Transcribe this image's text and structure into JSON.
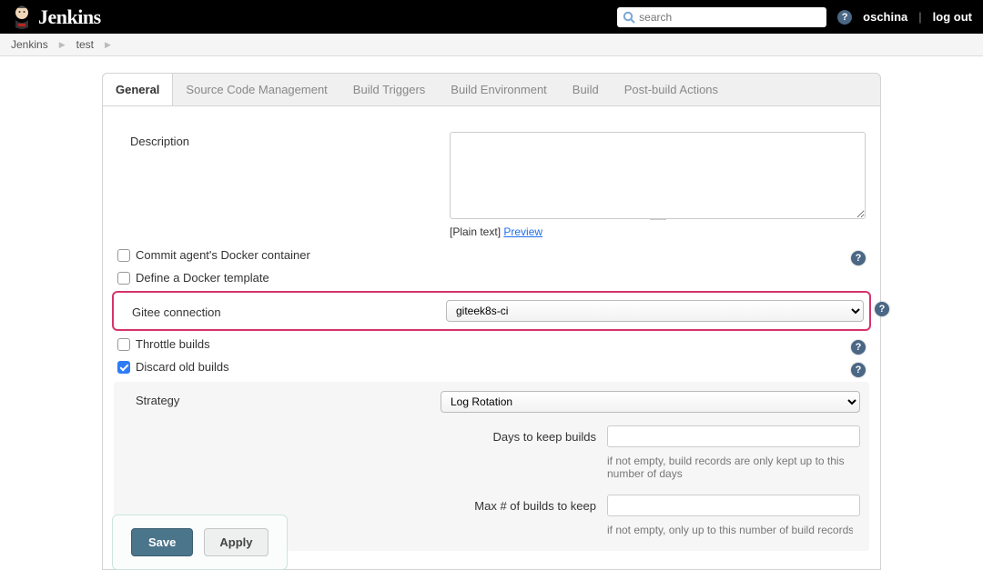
{
  "header": {
    "brand": "Jenkins",
    "search_placeholder": "search",
    "user": "oschina",
    "logout": "log out"
  },
  "breadcrumb": {
    "items": [
      "Jenkins",
      "test"
    ]
  },
  "tabs": {
    "general": "General",
    "scm": "Source Code Management",
    "triggers": "Build Triggers",
    "env": "Build Environment",
    "build": "Build",
    "post": "Post-build Actions"
  },
  "form": {
    "description_label": "Description",
    "description_value": "",
    "plain_text": "[Plain text]",
    "preview": "Preview",
    "commit_agent": "Commit agent's Docker container",
    "define_template": "Define a Docker template",
    "gitee_label": "Gitee connection",
    "gitee_options": [
      "giteek8s-ci"
    ],
    "gitee_selected": "giteek8s-ci",
    "throttle": "Throttle builds",
    "discard": "Discard old builds",
    "strategy_label": "Strategy",
    "strategy_options": [
      "Log Rotation"
    ],
    "strategy_selected": "Log Rotation",
    "days_label": "Days to keep builds",
    "days_help": "if not empty, build records are only kept up to this number of days",
    "max_label": "Max # of builds to keep",
    "max_help": "if not empty, only up to this number of build records"
  },
  "actions": {
    "save": "Save",
    "apply": "Apply"
  }
}
